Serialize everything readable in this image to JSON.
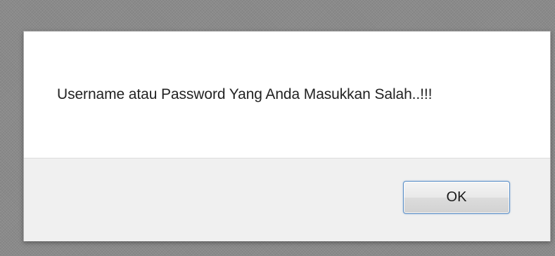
{
  "dialog": {
    "message": "Username atau Password Yang Anda Masukkan Salah..!!!",
    "ok_label": "OK"
  },
  "colors": {
    "backdrop": "#8a8a8a",
    "dialog_body": "#ffffff",
    "dialog_footer": "#f0f0f0",
    "button_focus_border": "#5b8fc6"
  }
}
